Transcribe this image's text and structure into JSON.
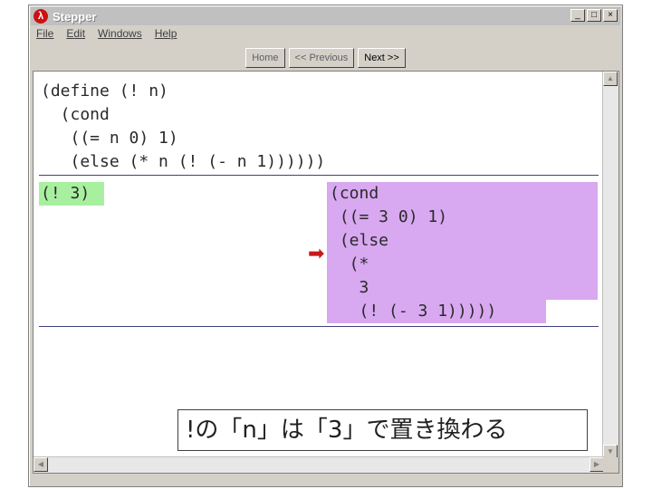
{
  "window": {
    "title": "Stepper",
    "icon": "lambda-icon",
    "controls": [
      "_",
      "□",
      "×"
    ]
  },
  "menu": [
    "File",
    "Edit",
    "Windows",
    "Help"
  ],
  "toolbar": {
    "home": "Home",
    "previous": "<< Previous",
    "next": "Next >>"
  },
  "definition": "(define (! n)\n  (cond\n   ((= n 0) 1)\n   (else (* n (! (- n 1))))))",
  "redex": "(! 3)",
  "result": "(cond\n ((= 3 0) 1)\n (else\n  (*\n   3\n   (! (- 3 1)))))",
  "arrow": "➡",
  "caption": "!の「n」は「3」で置き換わる",
  "colors": {
    "redex_highlight": "#a8f0a0",
    "result_highlight": "#d8a8f0",
    "arrow": "#c81818"
  }
}
